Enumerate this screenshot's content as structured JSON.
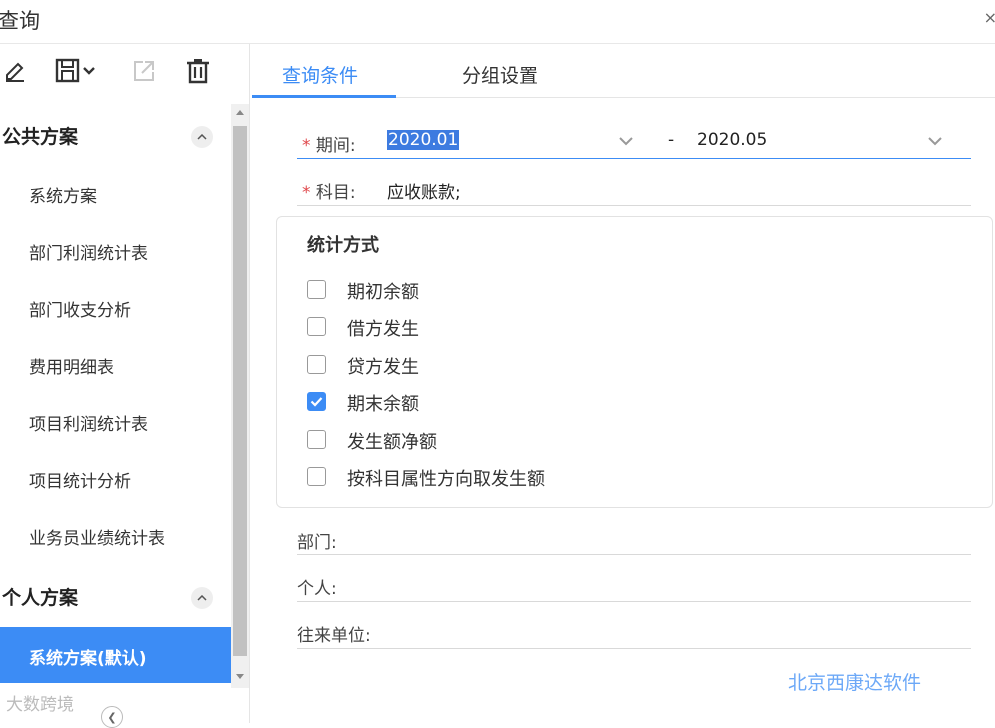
{
  "window": {
    "title": "查询",
    "close_glyph": "×"
  },
  "toolbar": {
    "icons": [
      "edit-icon",
      "save-icon",
      "export-icon",
      "delete-icon"
    ]
  },
  "sidebar": {
    "groups": [
      {
        "title": "公共方案",
        "items": [
          "系统方案",
          "部门利润统计表",
          "部门收支分析",
          "费用明细表",
          "项目利润统计表",
          "项目统计分析",
          "业务员业绩统计表"
        ]
      },
      {
        "title": "个人方案",
        "items": [
          "系统方案(默认)"
        ]
      }
    ],
    "selected_item": "系统方案(默认)"
  },
  "tabs": [
    {
      "label": "查询条件",
      "active": true
    },
    {
      "label": "分组设置",
      "active": false
    }
  ],
  "form": {
    "period": {
      "label": "期间:",
      "required_mark": "*",
      "from": "2020.01",
      "separator": "-",
      "to": "2020.05"
    },
    "subject": {
      "label": "科目:",
      "required_mark": "*",
      "value": "应收账款;"
    },
    "stat_method": {
      "title": "统计方式",
      "options": [
        {
          "label": "期初余额",
          "checked": false
        },
        {
          "label": "借方发生",
          "checked": false
        },
        {
          "label": "贷方发生",
          "checked": false
        },
        {
          "label": "期末余额",
          "checked": true
        },
        {
          "label": "发生额净额",
          "checked": false
        },
        {
          "label": "按科目属性方向取发生额",
          "checked": false
        }
      ]
    },
    "department": {
      "label": "部门:"
    },
    "person": {
      "label": "个人:"
    },
    "partner": {
      "label": "往来单位:"
    }
  },
  "watermarks": {
    "right": "北京西康达软件",
    "left": "大数跨境"
  },
  "colors": {
    "accent": "#3c8cf5",
    "required": "#e0474b"
  }
}
